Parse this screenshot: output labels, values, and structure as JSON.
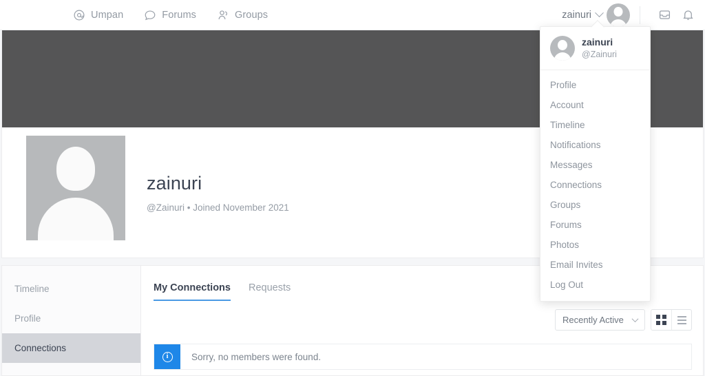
{
  "topnav": {
    "items": [
      {
        "label": "Umpan",
        "icon": "at-circle-icon"
      },
      {
        "label": "Forums",
        "icon": "chat-bubble-icon"
      },
      {
        "label": "Groups",
        "icon": "people-icon"
      }
    ],
    "user": {
      "name": "zainuri"
    },
    "messages_icon": "inbox-icon",
    "notifications_icon": "bell-icon"
  },
  "dropdown": {
    "name": "zainuri",
    "handle": "@Zainuri",
    "items": [
      "Profile",
      "Account",
      "Timeline",
      "Notifications",
      "Messages",
      "Connections",
      "Groups",
      "Forums",
      "Photos",
      "Email Invites",
      "Log Out"
    ]
  },
  "profile": {
    "name": "zainuri",
    "meta": "@Zainuri • Joined November 2021"
  },
  "sidebar": {
    "items": [
      {
        "label": "Timeline",
        "active": false
      },
      {
        "label": "Profile",
        "active": false
      },
      {
        "label": "Connections",
        "active": true
      }
    ]
  },
  "main": {
    "tabs": [
      {
        "label": "My Connections",
        "active": true
      },
      {
        "label": "Requests",
        "active": false
      }
    ],
    "sort": {
      "value": "Recently Active"
    },
    "views": [
      {
        "name": "grid-view",
        "active": true
      },
      {
        "name": "list-view",
        "active": false
      }
    ],
    "notice": {
      "text": "Sorry, no members were found.",
      "icon": "info-icon",
      "symbol": "i"
    }
  },
  "colors": {
    "accent": "#4a9ae4",
    "info": "#1e87e8",
    "cover": "#555556",
    "text_dark": "#3c4453",
    "text_muted": "#9aa1aa"
  }
}
